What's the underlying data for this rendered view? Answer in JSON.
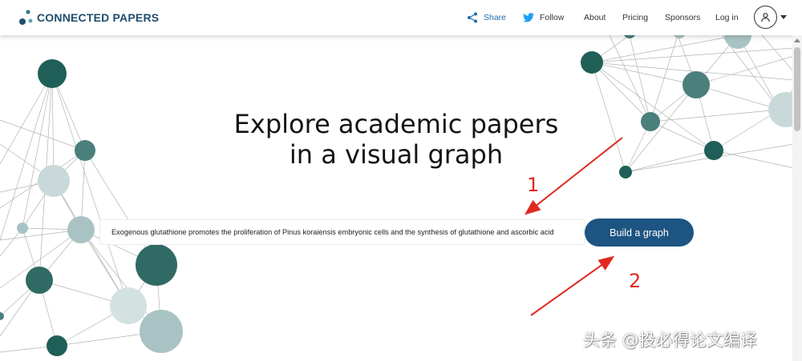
{
  "brand": {
    "name": "CONNECTED PAPERS",
    "color": "#1f4e6b"
  },
  "nav": {
    "share": "Share",
    "follow": "Follow",
    "about": "About",
    "pricing": "Pricing",
    "sponsors": "Sponsors",
    "login": "Log in"
  },
  "icons": {
    "share": "share-icon",
    "follow": "twitter-icon",
    "account": "user-icon",
    "menu": "chevron-down-icon"
  },
  "hero": {
    "title_line1": "Explore academic papers",
    "title_line2": "in a visual graph"
  },
  "search": {
    "value": "Exogenous glutathione promotes the proliferation of Pinus koraiensis embryonic cells and the synthesis of glutathione and ascorbic acid"
  },
  "build_button": {
    "label": "Build a graph",
    "color": "#1d5482"
  },
  "annotations": {
    "step1": "1",
    "step2": "2",
    "color": "#e0281f"
  },
  "watermark": "头条 @投必得论文编译",
  "colors": {
    "node_dark": "#1f5f57",
    "node_mid": "#4a7f7c",
    "node_light": "#c9d9d9"
  }
}
